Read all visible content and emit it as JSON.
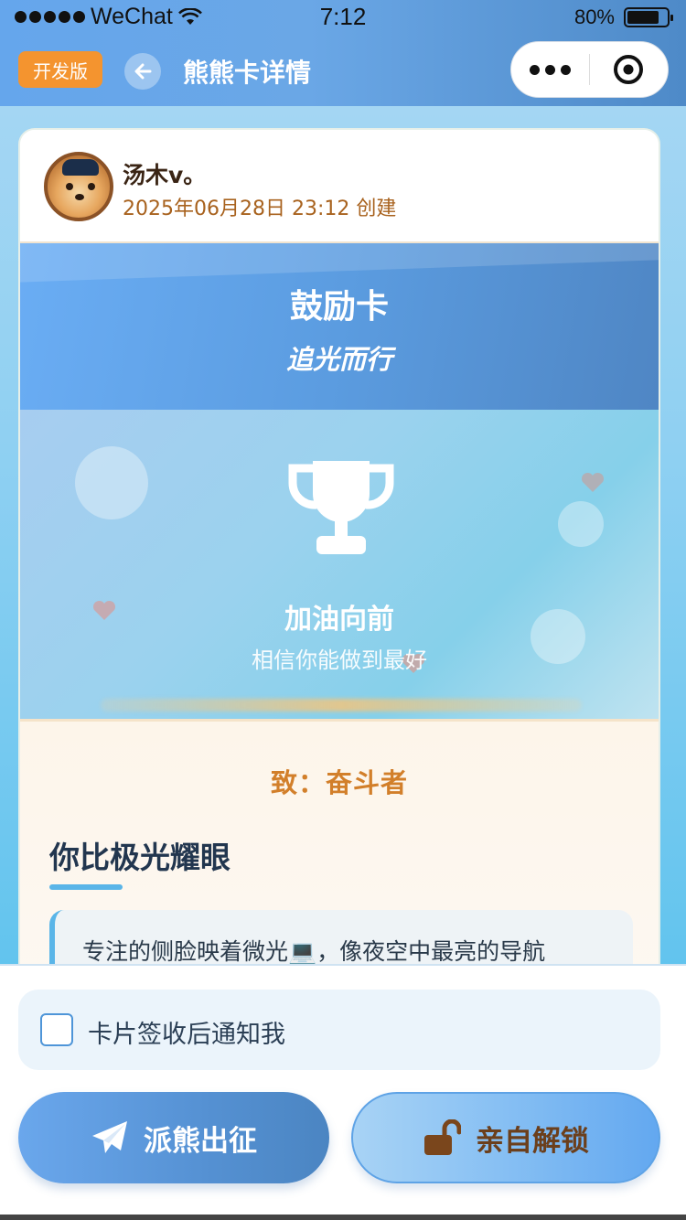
{
  "status_bar": {
    "carrier": "WeChat",
    "time": "7:12",
    "battery_text": "80%",
    "battery_level": 0.8
  },
  "nav": {
    "dev_badge": "开发版",
    "title": "熊熊卡详情"
  },
  "card": {
    "user_name": "汤木v。",
    "created": "2025年06月28日 23:12 创建",
    "banner_title": "鼓励卡",
    "banner_subtitle": "追光而行",
    "scene_title": "加油向前",
    "scene_subtitle": "相信你能做到最好",
    "to_line": "致：奋斗者",
    "heading": "你比极光耀眼",
    "quote": "专注的侧脸映着微光💻，像夜空中最亮的导航"
  },
  "bottom": {
    "notify_label": "卡片签收后通知我",
    "notify_checked": false,
    "send_button": "派熊出征",
    "unlock_button": "亲自解锁"
  },
  "colors": {
    "accent_blue": "#5591d3",
    "dev_badge": "#f4942f",
    "brown_text": "#a8621e",
    "orange_text": "#d27f2a"
  },
  "icons": [
    "wifi-icon",
    "back-arrow-icon",
    "more-dots-icon",
    "close-target-icon",
    "trophy-icon",
    "heart-icon",
    "paper-plane-icon",
    "unlock-icon"
  ]
}
